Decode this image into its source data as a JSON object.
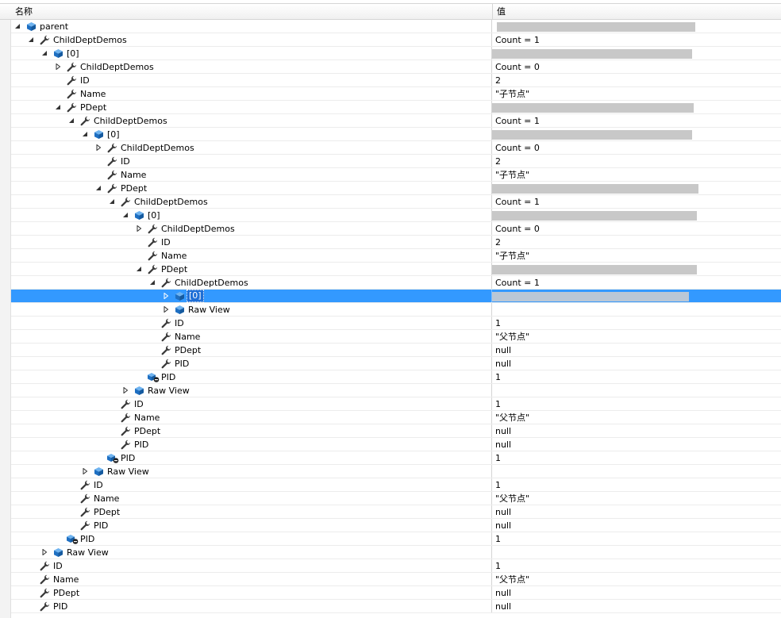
{
  "header": {
    "name_col": "名称",
    "value_col": "值"
  },
  "rows": [
    {
      "depth": 0,
      "exp": "open",
      "icon": "object",
      "name": "parent",
      "value": "",
      "blur": [
        6,
        250
      ]
    },
    {
      "depth": 1,
      "exp": "open",
      "icon": "prop",
      "name": "ChildDeptDemos",
      "value": "Count = 1",
      "blur": [
        0,
        0
      ]
    },
    {
      "depth": 2,
      "exp": "open",
      "icon": "object",
      "name": "[0]",
      "value": "",
      "blur": [
        0,
        252
      ]
    },
    {
      "depth": 3,
      "exp": "closed",
      "icon": "prop",
      "name": "ChildDeptDemos",
      "value": "Count = 0",
      "blur": [
        0,
        0
      ]
    },
    {
      "depth": 3,
      "exp": "none",
      "icon": "prop",
      "name": "ID",
      "value": "2",
      "blur": [
        0,
        0
      ]
    },
    {
      "depth": 3,
      "exp": "none",
      "icon": "prop",
      "name": "Name",
      "value": "\"子节点\"",
      "blur": [
        0,
        0
      ]
    },
    {
      "depth": 3,
      "exp": "open",
      "icon": "prop",
      "name": "PDept",
      "value": "",
      "blur": [
        0,
        254
      ]
    },
    {
      "depth": 4,
      "exp": "open",
      "icon": "prop",
      "name": "ChildDeptDemos",
      "value": "Count = 1",
      "blur": [
        0,
        0
      ]
    },
    {
      "depth": 5,
      "exp": "open",
      "icon": "object",
      "name": "[0]",
      "value": "",
      "blur": [
        0,
        252
      ]
    },
    {
      "depth": 6,
      "exp": "closed",
      "icon": "prop",
      "name": "ChildDeptDemos",
      "value": "Count = 0",
      "blur": [
        0,
        0
      ]
    },
    {
      "depth": 6,
      "exp": "none",
      "icon": "prop",
      "name": "ID",
      "value": "2",
      "blur": [
        0,
        0
      ]
    },
    {
      "depth": 6,
      "exp": "none",
      "icon": "prop",
      "name": "Name",
      "value": "\"子节点\"",
      "blur": [
        0,
        0
      ]
    },
    {
      "depth": 6,
      "exp": "open",
      "icon": "prop",
      "name": "PDept",
      "value": "",
      "blur": [
        0,
        260
      ]
    },
    {
      "depth": 7,
      "exp": "open",
      "icon": "prop",
      "name": "ChildDeptDemos",
      "value": "Count = 1",
      "blur": [
        0,
        0
      ]
    },
    {
      "depth": 8,
      "exp": "open",
      "icon": "object",
      "name": "[0]",
      "value": "",
      "blur": [
        0,
        258
      ]
    },
    {
      "depth": 9,
      "exp": "closed",
      "icon": "prop",
      "name": "ChildDeptDemos",
      "value": "Count = 0",
      "blur": [
        0,
        0
      ]
    },
    {
      "depth": 9,
      "exp": "none",
      "icon": "prop",
      "name": "ID",
      "value": "2",
      "blur": [
        0,
        0
      ]
    },
    {
      "depth": 9,
      "exp": "none",
      "icon": "prop",
      "name": "Name",
      "value": "\"子节点\"",
      "blur": [
        0,
        0
      ]
    },
    {
      "depth": 9,
      "exp": "open",
      "icon": "prop",
      "name": "PDept",
      "value": "",
      "blur": [
        0,
        258
      ]
    },
    {
      "depth": 10,
      "exp": "open",
      "icon": "prop",
      "name": "ChildDeptDemos",
      "value": "Count = 1",
      "blur": [
        0,
        0
      ]
    },
    {
      "depth": 11,
      "exp": "closed",
      "icon": "object",
      "name": "[0]",
      "value": "",
      "blur": [
        0,
        248
      ],
      "selected": true
    },
    {
      "depth": 11,
      "exp": "closed",
      "icon": "object",
      "name": "Raw View",
      "value": "",
      "blur": [
        0,
        0
      ]
    },
    {
      "depth": 10,
      "exp": "none",
      "icon": "prop",
      "name": "ID",
      "value": "1",
      "blur": [
        0,
        0
      ]
    },
    {
      "depth": 10,
      "exp": "none",
      "icon": "prop",
      "name": "Name",
      "value": "\"父节点\"",
      "blur": [
        0,
        0
      ]
    },
    {
      "depth": 10,
      "exp": "none",
      "icon": "prop",
      "name": "PDept",
      "value": "null",
      "blur": [
        0,
        0
      ]
    },
    {
      "depth": 10,
      "exp": "none",
      "icon": "prop",
      "name": "PID",
      "value": "null",
      "blur": [
        0,
        0
      ]
    },
    {
      "depth": 9,
      "exp": "none",
      "icon": "field",
      "name": "PID",
      "value": "1",
      "blur": [
        0,
        0
      ]
    },
    {
      "depth": 8,
      "exp": "closed",
      "icon": "object",
      "name": "Raw View",
      "value": "",
      "blur": [
        0,
        0
      ]
    },
    {
      "depth": 7,
      "exp": "none",
      "icon": "prop",
      "name": "ID",
      "value": "1",
      "blur": [
        0,
        0
      ]
    },
    {
      "depth": 7,
      "exp": "none",
      "icon": "prop",
      "name": "Name",
      "value": "\"父节点\"",
      "blur": [
        0,
        0
      ]
    },
    {
      "depth": 7,
      "exp": "none",
      "icon": "prop",
      "name": "PDept",
      "value": "null",
      "blur": [
        0,
        0
      ]
    },
    {
      "depth": 7,
      "exp": "none",
      "icon": "prop",
      "name": "PID",
      "value": "null",
      "blur": [
        0,
        0
      ]
    },
    {
      "depth": 6,
      "exp": "none",
      "icon": "field",
      "name": "PID",
      "value": "1",
      "blur": [
        0,
        0
      ]
    },
    {
      "depth": 5,
      "exp": "closed",
      "icon": "object",
      "name": "Raw View",
      "value": "",
      "blur": [
        0,
        0
      ]
    },
    {
      "depth": 4,
      "exp": "none",
      "icon": "prop",
      "name": "ID",
      "value": "1",
      "blur": [
        0,
        0
      ]
    },
    {
      "depth": 4,
      "exp": "none",
      "icon": "prop",
      "name": "Name",
      "value": "\"父节点\"",
      "blur": [
        0,
        0
      ]
    },
    {
      "depth": 4,
      "exp": "none",
      "icon": "prop",
      "name": "PDept",
      "value": "null",
      "blur": [
        0,
        0
      ]
    },
    {
      "depth": 4,
      "exp": "none",
      "icon": "prop",
      "name": "PID",
      "value": "null",
      "blur": [
        0,
        0
      ]
    },
    {
      "depth": 3,
      "exp": "none",
      "icon": "field",
      "name": "PID",
      "value": "1",
      "blur": [
        0,
        0
      ]
    },
    {
      "depth": 2,
      "exp": "closed",
      "icon": "object",
      "name": "Raw View",
      "value": "",
      "blur": [
        0,
        0
      ]
    },
    {
      "depth": 1,
      "exp": "none",
      "icon": "prop",
      "name": "ID",
      "value": "1",
      "blur": [
        0,
        0
      ]
    },
    {
      "depth": 1,
      "exp": "none",
      "icon": "prop",
      "name": "Name",
      "value": "\"父节点\"",
      "blur": [
        0,
        0
      ]
    },
    {
      "depth": 1,
      "exp": "none",
      "icon": "prop",
      "name": "PDept",
      "value": "null",
      "blur": [
        0,
        0
      ]
    },
    {
      "depth": 1,
      "exp": "none",
      "icon": "prop",
      "name": "PID",
      "value": "null",
      "blur": [
        0,
        0
      ]
    }
  ],
  "colors": {
    "selection": "#3399ff",
    "object_icon": "#1e7ad6",
    "wrench_icon": "#3c3c3c",
    "redacted": "#c8c8c8"
  },
  "icons": {
    "object": "object-cube-icon",
    "prop": "wrench-property-icon",
    "field": "field-minus-icon",
    "open": "triangle-open-icon",
    "closed": "triangle-closed-icon"
  }
}
